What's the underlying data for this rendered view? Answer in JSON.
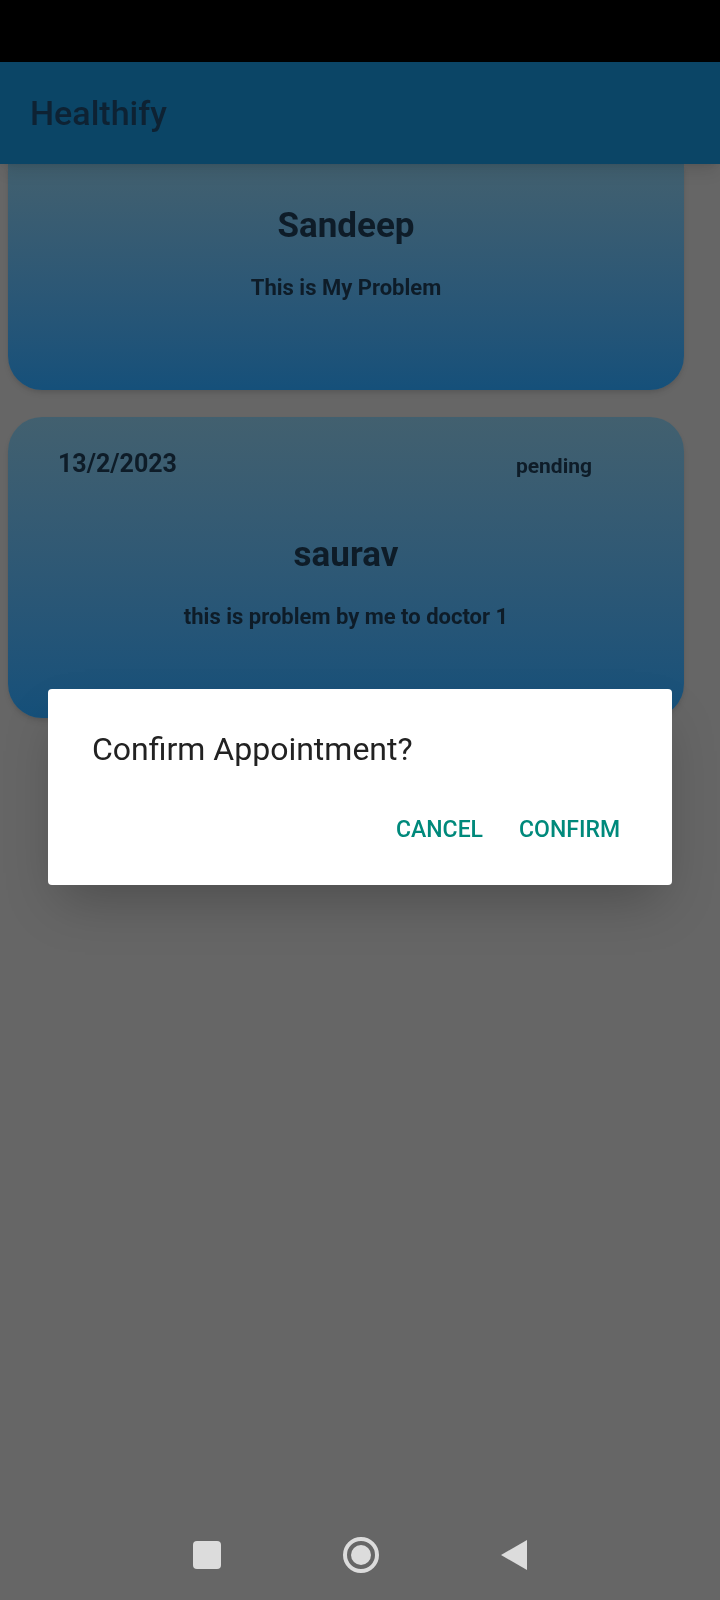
{
  "app_bar": {
    "title": "Healthify"
  },
  "appointments": [
    {
      "name": "Sandeep",
      "problem": "This is My Problem"
    },
    {
      "date": "13/2/2023",
      "status": "pending",
      "name": "saurav",
      "problem": "this is problem by me to doctor 1"
    }
  ],
  "dialog": {
    "title": "Confirm Appointment?",
    "buttons": [
      "CANCEL",
      "CONFIRM"
    ]
  }
}
